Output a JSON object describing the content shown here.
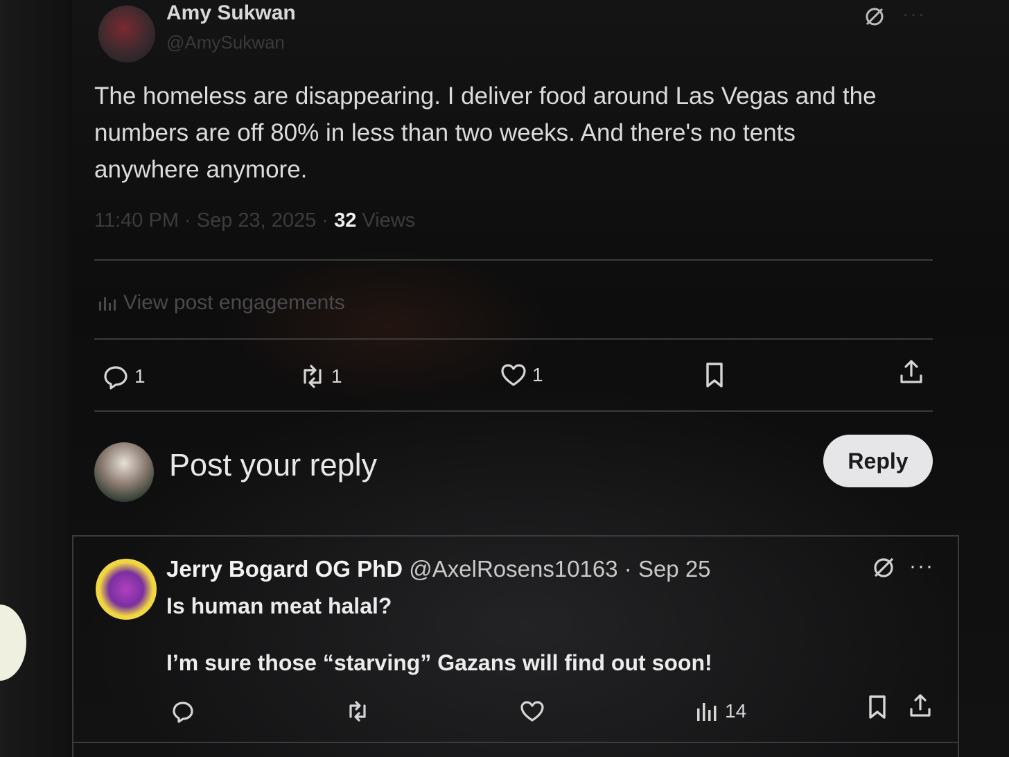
{
  "post": {
    "author_name": "Amy Sukwan",
    "author_handle": "@AmySukwan",
    "text_line1": "The homeless are disappearing. I deliver food around Las Vegas and the",
    "text_line2": "numbers are off 80% in less than two weeks. And there's no tents",
    "text_line3": "anywhere anymore.",
    "time": "11:40 PM · Sep 23, 2025 · ",
    "views_count": "32",
    "views_label": " Views",
    "engagements_label": "View post engagements",
    "replies": "1",
    "reposts": "1",
    "likes": "1"
  },
  "composer": {
    "placeholder": "Post your reply",
    "reply_button": "Reply"
  },
  "reply": {
    "author_name": "Jerry Bogard OG PhD",
    "author_handle": " @AxelRosens10163 · Sep 25",
    "line1": "Is human meat halal?",
    "line2": "I’m sure those “starving” Gazans will find out soon!",
    "views": "14",
    "more": "···"
  },
  "top_more": "···",
  "colors": {
    "background": "#0d0d0d",
    "text": "#e7e9ea",
    "reply_button_bg": "#e6e6e8",
    "divider": "#3a3b3d"
  },
  "icons": [
    "grok-icon",
    "more-icon",
    "analytics-icon",
    "reply-icon",
    "repost-icon",
    "like-icon",
    "bookmark-icon",
    "share-icon"
  ]
}
